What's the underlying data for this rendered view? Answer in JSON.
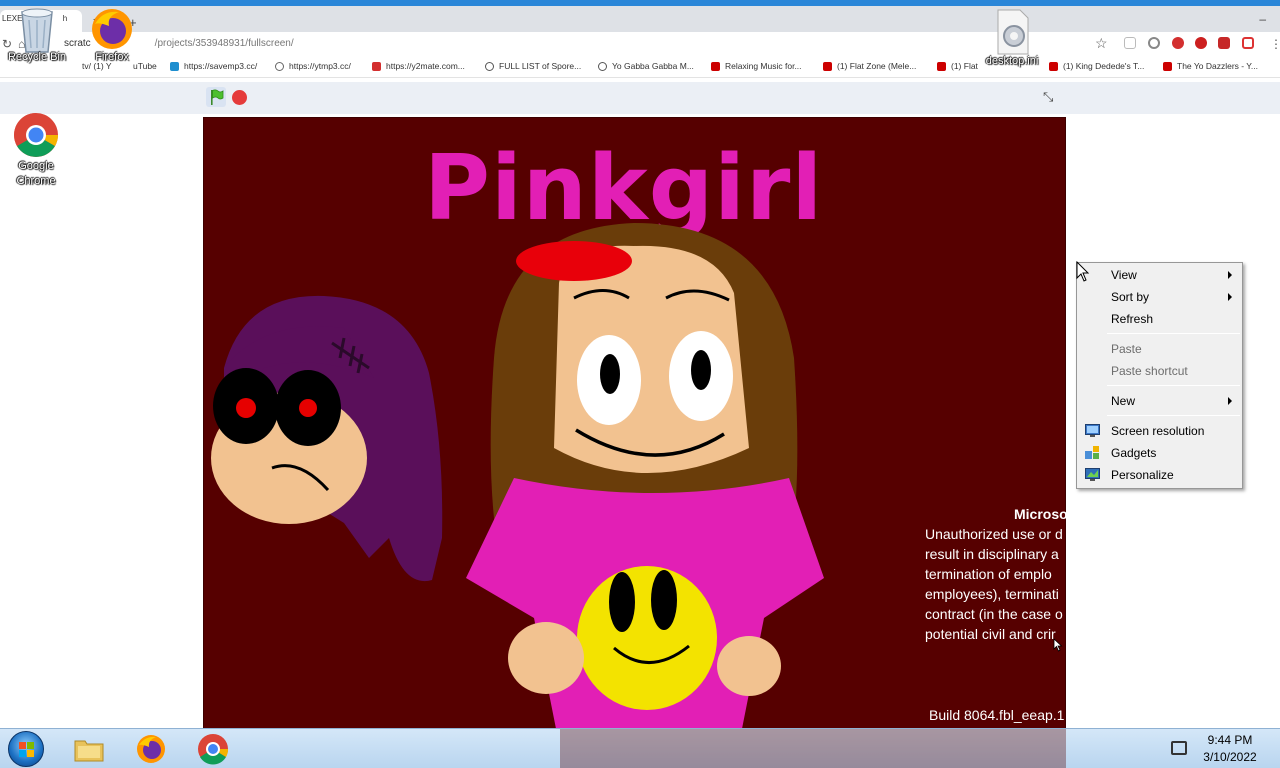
{
  "browser": {
    "tab_text": "LEXE",
    "tab_text_suffix": "h",
    "url_prefix": "scratc",
    "url_rest": "/projects/353948931/fullscreen/",
    "bookmarks": [
      {
        "label": "tv/ (1) Y",
        "icon": "bookmark-icon",
        "color": "#999999"
      },
      {
        "label": "uTube",
        "icon": "youtube-icon",
        "color": "#cc0000"
      },
      {
        "label": "https://savemp3.cc/",
        "icon": "savemp3-icon",
        "color": "#1e8ecf"
      },
      {
        "label": "https://ytmp3.cc/",
        "icon": "ytmp3-icon",
        "color": "#666666"
      },
      {
        "label": "https://y2mate.com...",
        "icon": "y2mate-icon",
        "color": "#d32f2f"
      },
      {
        "label": "FULL LIST of Spore...",
        "icon": "globe-icon",
        "color": "#555555"
      },
      {
        "label": "Yo Gabba Gabba M...",
        "icon": "globe-icon",
        "color": "#555555"
      },
      {
        "label": "Relaxing Music for...",
        "icon": "youtube-icon",
        "color": "#cc0000"
      },
      {
        "label": "(1) Flat Zone (Mele...",
        "icon": "youtube-icon",
        "color": "#cc0000"
      },
      {
        "label": "(1) Flat",
        "icon": "youtube-icon",
        "color": "#cc0000"
      },
      {
        "label": "(1) King Dedede's T...",
        "icon": "youtube-icon",
        "color": "#cc0000"
      },
      {
        "label": "The Yo Dazzlers - Y...",
        "icon": "youtube-icon",
        "color": "#cc0000"
      }
    ]
  },
  "desktop": {
    "icons": [
      {
        "label": "Recycle Bin",
        "icon": "recycle-bin-icon"
      },
      {
        "label": "Firefox",
        "icon": "firefox-icon"
      },
      {
        "label": "Google Chrome",
        "icon": "chrome-icon"
      },
      {
        "label": "desktop.ini",
        "icon": "ini-file-icon"
      }
    ]
  },
  "stage": {
    "title": "Pinkgirl",
    "background": "#560000",
    "title_color": "#e21fb5"
  },
  "context_menu": {
    "items": [
      {
        "label": "View",
        "submenu": true,
        "disabled": false
      },
      {
        "label": "Sort by",
        "submenu": true,
        "disabled": false
      },
      {
        "label": "Refresh",
        "submenu": false,
        "disabled": false
      },
      {
        "label": "Paste",
        "submenu": false,
        "disabled": true
      },
      {
        "label": "Paste shortcut",
        "submenu": false,
        "disabled": true
      },
      {
        "label": "New",
        "submenu": true,
        "disabled": false
      },
      {
        "label": "Screen resolution",
        "submenu": false,
        "disabled": false,
        "icon": "screen-resolution-icon"
      },
      {
        "label": "Gadgets",
        "submenu": false,
        "disabled": false,
        "icon": "gadgets-icon"
      },
      {
        "label": "Personalize",
        "submenu": false,
        "disabled": false,
        "icon": "personalize-icon"
      }
    ]
  },
  "notice": {
    "title": "Microso",
    "lines": [
      "Unauthorized use or d",
      "result in disciplinary a",
      "termination of emplo",
      "employees), terminati",
      "contract (in the case o",
      "potential civil and crir"
    ],
    "build": "Build 8064.fbl_eeap.1"
  },
  "taskbar": {
    "apps": [
      {
        "name": "File Explorer",
        "icon": "folder-icon"
      },
      {
        "name": "Firefox",
        "icon": "firefox-icon"
      },
      {
        "name": "Google Chrome",
        "icon": "chrome-icon"
      }
    ],
    "time": "9:44 PM",
    "date": "3/10/2022"
  }
}
